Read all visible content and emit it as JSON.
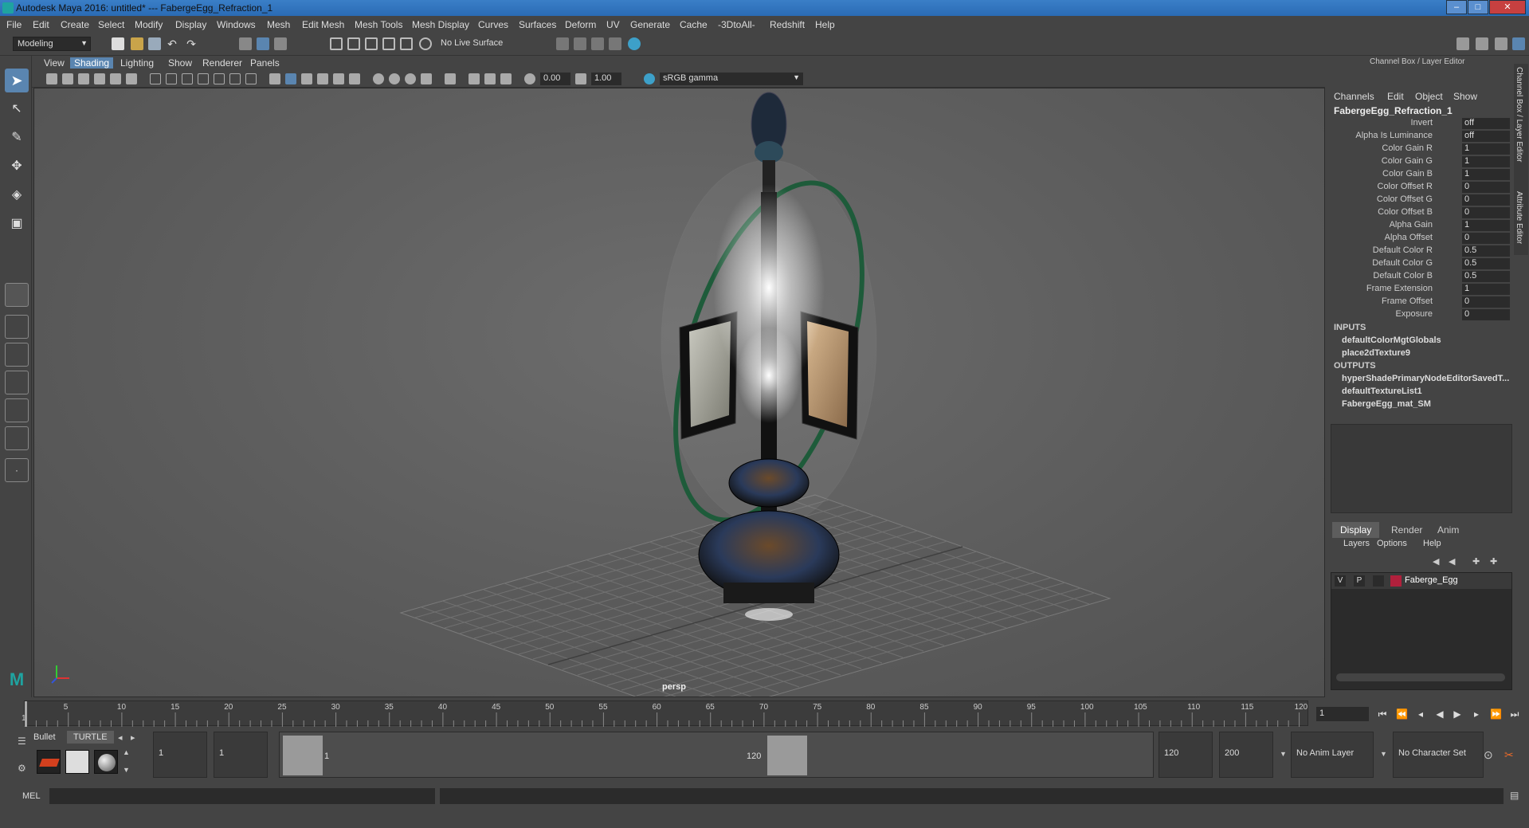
{
  "window": {
    "title": "Autodesk Maya 2016: untitled*   ---   FabergeEgg_Refraction_1",
    "min": "–",
    "max": "□",
    "close": "✕"
  },
  "menubar": [
    "File",
    "Edit",
    "Create",
    "Select",
    "Modify",
    "Display",
    "Windows",
    "Mesh",
    "Edit Mesh",
    "Mesh Tools",
    "Mesh Display",
    "Curves",
    "Surfaces",
    "Deform",
    "UV",
    "Generate",
    "Cache",
    "-3DtoAll-",
    "Redshift",
    "Help"
  ],
  "statusline": {
    "mode": "Modeling",
    "live_surface": "No Live Surface"
  },
  "viewport": {
    "menus": [
      "View",
      "Shading",
      "Lighting",
      "Show",
      "Renderer",
      "Panels"
    ],
    "active_menu": "Shading",
    "exposure": "0.00",
    "gamma_value": "1.00",
    "color_space": "sRGB gamma",
    "camera": "persp"
  },
  "channel_box": {
    "title": "Channel Box / Layer Editor",
    "menus": [
      "Channels",
      "Edit",
      "Object",
      "Show"
    ],
    "node": "FabergeEgg_Refraction_1",
    "attributes": [
      {
        "name": "Invert",
        "value": "off"
      },
      {
        "name": "Alpha Is Luminance",
        "value": "off"
      },
      {
        "name": "Color Gain R",
        "value": "1"
      },
      {
        "name": "Color Gain G",
        "value": "1"
      },
      {
        "name": "Color Gain B",
        "value": "1"
      },
      {
        "name": "Color Offset R",
        "value": "0"
      },
      {
        "name": "Color Offset G",
        "value": "0"
      },
      {
        "name": "Color Offset B",
        "value": "0"
      },
      {
        "name": "Alpha Gain",
        "value": "1"
      },
      {
        "name": "Alpha Offset",
        "value": "0"
      },
      {
        "name": "Default Color R",
        "value": "0.5"
      },
      {
        "name": "Default Color G",
        "value": "0.5"
      },
      {
        "name": "Default Color B",
        "value": "0.5"
      },
      {
        "name": "Frame Extension",
        "value": "1"
      },
      {
        "name": "Frame Offset",
        "value": "0"
      },
      {
        "name": "Exposure",
        "value": "0"
      }
    ],
    "inputs_label": "INPUTS",
    "inputs": [
      "defaultColorMgtGlobals",
      "place2dTexture9"
    ],
    "outputs_label": "OUTPUTS",
    "outputs": [
      "hyperShadePrimaryNodeEditorSavedT...",
      "defaultTextureList1",
      "FabergeEgg_mat_SM"
    ]
  },
  "layer_editor": {
    "tabs": [
      "Display",
      "Render",
      "Anim"
    ],
    "active_tab": "Display",
    "menus": [
      "Layers",
      "Options",
      "Help"
    ],
    "layer": {
      "v": "V",
      "p": "P",
      "name": "Faberge_Egg",
      "color": "#b0203c"
    }
  },
  "side_tabs": [
    "Channel Box / Layer Editor",
    "Attribute Editor"
  ],
  "timeline": {
    "ticks": [
      "5",
      "10",
      "15",
      "20",
      "25",
      "30",
      "35",
      "40",
      "45",
      "50",
      "55",
      "60",
      "65",
      "70",
      "75",
      "80",
      "85",
      "90",
      "95",
      "100",
      "105",
      "110",
      "115",
      "120"
    ],
    "start_label": "1",
    "current_frame": "1"
  },
  "shelf": {
    "tabs": [
      "Bullet",
      "TURTLE"
    ],
    "active": "TURTLE"
  },
  "range": {
    "start": "1",
    "playback_start": "1",
    "slider_start": "1",
    "slider_end": "120",
    "playback_end": "120",
    "end": "200",
    "anim_layer": "No Anim Layer",
    "char_set": "No Character Set"
  },
  "cmd": {
    "label": "MEL"
  }
}
